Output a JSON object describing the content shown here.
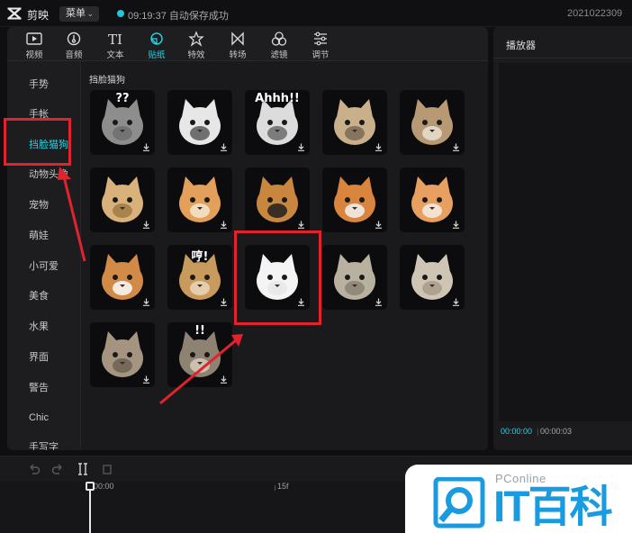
{
  "titlebar": {
    "app_name": "剪映",
    "menu_label": "菜单",
    "save_status": "09:19:37 自动保存成功",
    "project_name": "2021022309",
    "accent_color": "#22c7d6"
  },
  "toolbar": {
    "tools": [
      {
        "label": "视频",
        "icon": "video-icon"
      },
      {
        "label": "音频",
        "icon": "audio-icon"
      },
      {
        "label": "文本",
        "icon": "text-icon"
      },
      {
        "label": "贴纸",
        "icon": "sticker-icon",
        "active": true
      },
      {
        "label": "特效",
        "icon": "effects-icon"
      },
      {
        "label": "转场",
        "icon": "transition-icon"
      },
      {
        "label": "滤镜",
        "icon": "filter-icon"
      },
      {
        "label": "调节",
        "icon": "adjust-icon"
      }
    ]
  },
  "sidebar": {
    "items": [
      "手势",
      "手帐",
      "挡脸猫狗",
      "动物头像",
      "宠物",
      "萌娃",
      "小可爱",
      "美食",
      "水果",
      "界面",
      "警告",
      "Chic",
      "手写字"
    ],
    "active_index": 2
  },
  "content": {
    "category_title": "挡脸猫狗",
    "stickers": [
      {
        "icon": "grey-cat-question-sticker",
        "caption": "??"
      },
      {
        "icon": "bowtie-cat-sticker",
        "caption": ""
      },
      {
        "icon": "cat-ahhh-sticker",
        "caption": "Ahhh!!"
      },
      {
        "icon": "cat-with-hat-sticker",
        "caption": ""
      },
      {
        "icon": "cat-with-food-sticker",
        "caption": ""
      },
      {
        "icon": "cat-in-bread-sticker",
        "caption": ""
      },
      {
        "icon": "orange-cat-sticker",
        "caption": ""
      },
      {
        "icon": "shiba-hearts-sticker",
        "caption": ""
      },
      {
        "icon": "orange-cat-sparkle-sticker",
        "caption": ""
      },
      {
        "icon": "yawning-cat-sticker",
        "caption": ""
      },
      {
        "icon": "corgi-sticker",
        "caption": ""
      },
      {
        "icon": "angry-cat-hmph-sticker",
        "caption": "哼!"
      },
      {
        "icon": "samoyed-sticker",
        "caption": "",
        "highlighted": true
      },
      {
        "icon": "tabby-cat-sticker",
        "caption": ""
      },
      {
        "icon": "grey-tabby-cat-sticker",
        "caption": ""
      },
      {
        "icon": "tabby-cat-face-sticker",
        "caption": ""
      },
      {
        "icon": "cat-exclaim-sticker",
        "caption": "!!"
      }
    ]
  },
  "player": {
    "title": "播放器",
    "current_time": "00:00:00",
    "total_time": "00:00:03",
    "separator": "|"
  },
  "timeline": {
    "ruler_labels": [
      "00:00",
      "15f"
    ],
    "buttons": [
      "undo-icon",
      "redo-icon",
      "split-icon",
      "delete-icon"
    ]
  },
  "watermark": {
    "brand": "PConline",
    "name": "IT百科"
  }
}
